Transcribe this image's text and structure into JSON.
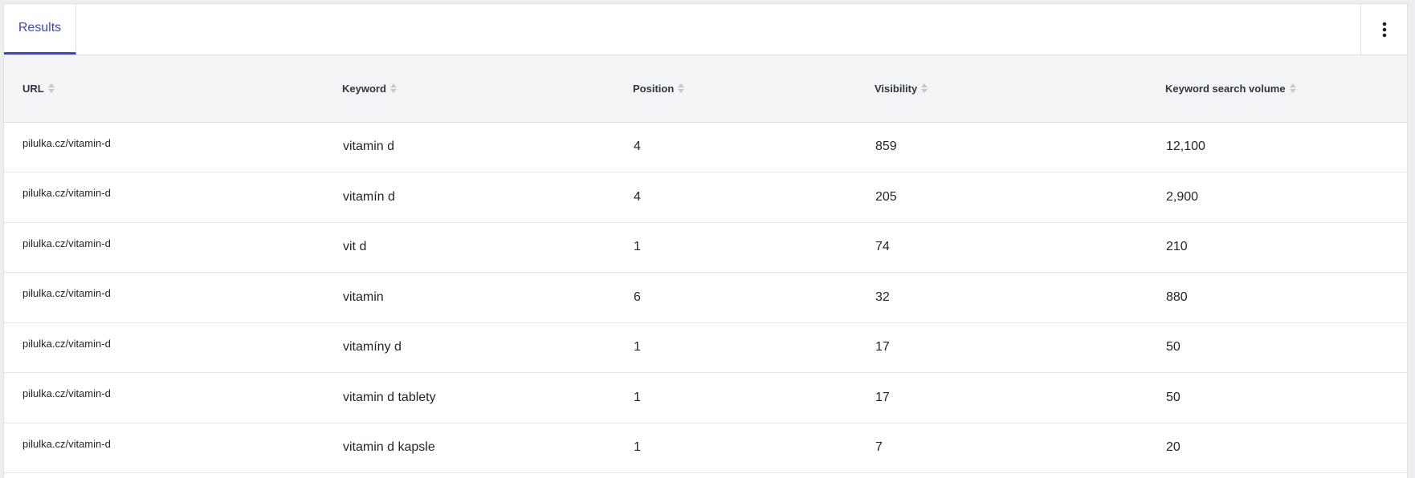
{
  "tabs": [
    {
      "label": "Results",
      "active": true
    }
  ],
  "menu": {
    "icon": "vertical-dots-icon"
  },
  "colors": {
    "accent": "#3d46c8",
    "header_bg": "#f4f4f6",
    "border": "#dfe1e6",
    "text": "#1f2330"
  },
  "table": {
    "columns": [
      "URL",
      "Keyword",
      "Position",
      "Visibility",
      "Keyword search volume"
    ],
    "rows": [
      {
        "url": "pilulka.cz/vitamin-d",
        "keyword": "vitamin d",
        "position": "4",
        "visibility": "859",
        "volume": "12,100"
      },
      {
        "url": "pilulka.cz/vitamin-d",
        "keyword": "vitamín d",
        "position": "4",
        "visibility": "205",
        "volume": "2,900"
      },
      {
        "url": "pilulka.cz/vitamin-d",
        "keyword": "vit d",
        "position": "1",
        "visibility": "74",
        "volume": "210"
      },
      {
        "url": "pilulka.cz/vitamin-d",
        "keyword": "vitamin",
        "position": "6",
        "visibility": "32",
        "volume": "880"
      },
      {
        "url": "pilulka.cz/vitamin-d",
        "keyword": "vitamíny d",
        "position": "1",
        "visibility": "17",
        "volume": "50"
      },
      {
        "url": "pilulka.cz/vitamin-d",
        "keyword": "vitamin d tablety",
        "position": "1",
        "visibility": "17",
        "volume": "50"
      },
      {
        "url": "pilulka.cz/vitamin-d",
        "keyword": "vitamin d kapsle",
        "position": "1",
        "visibility": "7",
        "volume": "20"
      }
    ]
  }
}
